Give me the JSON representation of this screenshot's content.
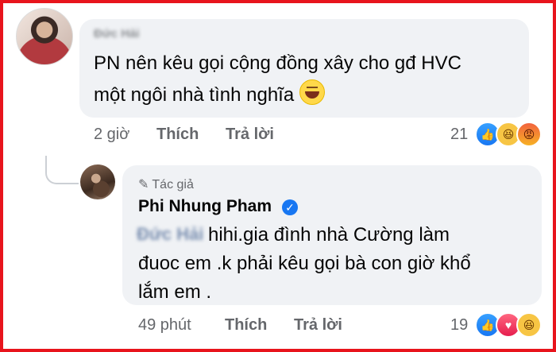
{
  "comment1": {
    "author": "Đức Hải",
    "text_line1": "PN nên kêu gọi cộng đồng xây cho gđ HVC",
    "text_line2": "một ngôi nhà tình nghĩa",
    "emoji": "grinning-face",
    "time": "2 giờ",
    "like_label": "Thích",
    "reply_label": "Trả lời",
    "reaction_count": "21",
    "reactions": [
      "like",
      "haha",
      "angry"
    ]
  },
  "reply": {
    "badge": "Tác giả",
    "author": "Phi Nhung Pham",
    "mention": "Đức Hải",
    "text_line1": "hihi.gia đình nhà Cường làm",
    "text_line2": "đuoc em .k phải kêu gọi bà con giờ khổ",
    "text_line3": "lắm em .",
    "time": "49 phút",
    "like_label": "Thích",
    "reply_label": "Trả lời",
    "reaction_count": "19",
    "reactions": [
      "like",
      "love",
      "haha"
    ]
  },
  "colors": {
    "frame_border": "#e8141c",
    "bubble": "#f0f2f5",
    "meta_text": "#65676b",
    "like_blue": "#1877f2"
  }
}
